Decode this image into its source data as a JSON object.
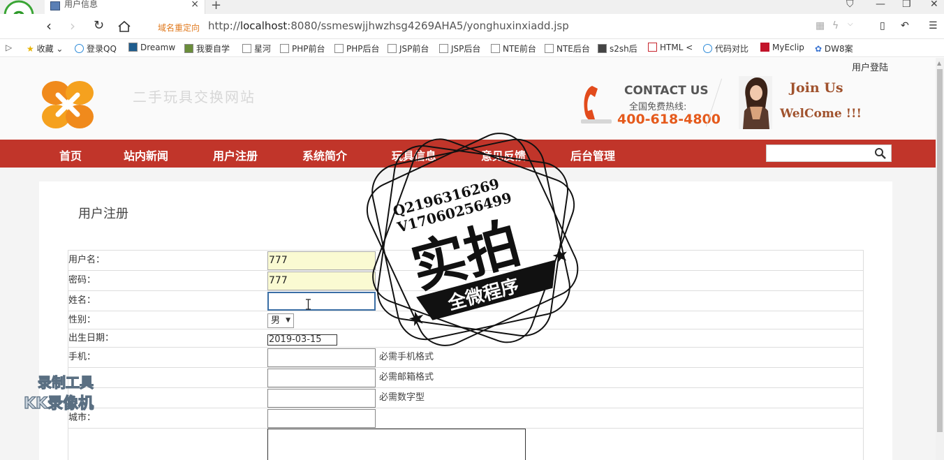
{
  "browser": {
    "tab_title": "用户信息",
    "redirect_label": "域名重定向",
    "url_prefix": "http://",
    "url_host": "localhost",
    "url_rest": ":8080/ssmeswjjhwzhsg4269AHA5/yonghuxinxiadd.jsp",
    "bookmarks": [
      "收藏",
      "登录QQ",
      "Dreamw",
      "我要自学",
      "星河",
      "PHP前台",
      "PHP后台",
      "JSP前台",
      "JSP后台",
      "NTE前台",
      "NTE后台",
      "s2sh后",
      "HTML <",
      "代码对比",
      "MyEclip",
      "DW8案"
    ]
  },
  "header": {
    "login_link": "用户登陆",
    "site_title": "二手玩具交换网站",
    "contact_title": "CONTACT US",
    "contact_sub": "全国免费热线:",
    "contact_phone": "400-618-4800",
    "join_us": "Join Us",
    "welcome": "WelCome !!!"
  },
  "nav": {
    "items": [
      "首页",
      "站内新闻",
      "用户注册",
      "系统简介",
      "玩具信息",
      "意见反馈",
      "后台管理"
    ]
  },
  "form": {
    "title": "用户注册",
    "fields": {
      "username": {
        "label": "用户名：",
        "value": "777"
      },
      "password": {
        "label": "密码：",
        "value": "777"
      },
      "name": {
        "label": "姓名：",
        "value": ""
      },
      "gender": {
        "label": "性别：",
        "value": "男"
      },
      "birthdate": {
        "label": "出生日期：",
        "value": "2019-03-15"
      },
      "phone": {
        "label": "手机：",
        "value": "",
        "hint": "必需手机格式"
      },
      "email": {
        "label": "",
        "value": "",
        "hint": "必需邮箱格式"
      },
      "number": {
        "label": "",
        "value": "",
        "hint": "必需数字型"
      },
      "city": {
        "label": "城市：",
        "value": ""
      }
    }
  },
  "overlays": {
    "stamp_line1": "Q2196316269",
    "stamp_line2": "V17060256499",
    "stamp_main": "实拍",
    "stamp_banner": "全微程序",
    "watermark_line1": "录制工具",
    "watermark_line2": "KK录像机"
  },
  "colors": {
    "nav_bg": "#c1352a",
    "accent_orange": "#e55a1c",
    "redirect": "#e07a1f"
  }
}
